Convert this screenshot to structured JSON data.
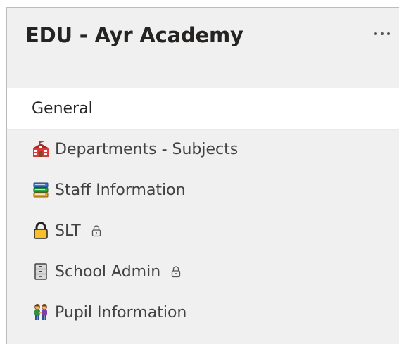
{
  "team": {
    "name": "EDU - Ayr Academy",
    "more_options_icon": "ellipsis-icon"
  },
  "channels": [
    {
      "label": "General",
      "icon": "",
      "selected": true,
      "private": false
    },
    {
      "label": "Departments - Subjects",
      "icon": "school-building-icon",
      "selected": false,
      "private": false
    },
    {
      "label": "Staff Information",
      "icon": "books-icon",
      "selected": false,
      "private": false
    },
    {
      "label": "SLT",
      "icon": "lock-icon",
      "selected": false,
      "private": true
    },
    {
      "label": "School Admin",
      "icon": "filing-cabinet-icon",
      "selected": false,
      "private": true
    },
    {
      "label": "Pupil Information",
      "icon": "people-holding-hands-icon",
      "selected": false,
      "private": false
    }
  ],
  "colors": {
    "panel_background": "#f0f0f0",
    "selected_background": "#ffffff",
    "title_text": "#252423",
    "channel_text": "#424242"
  }
}
